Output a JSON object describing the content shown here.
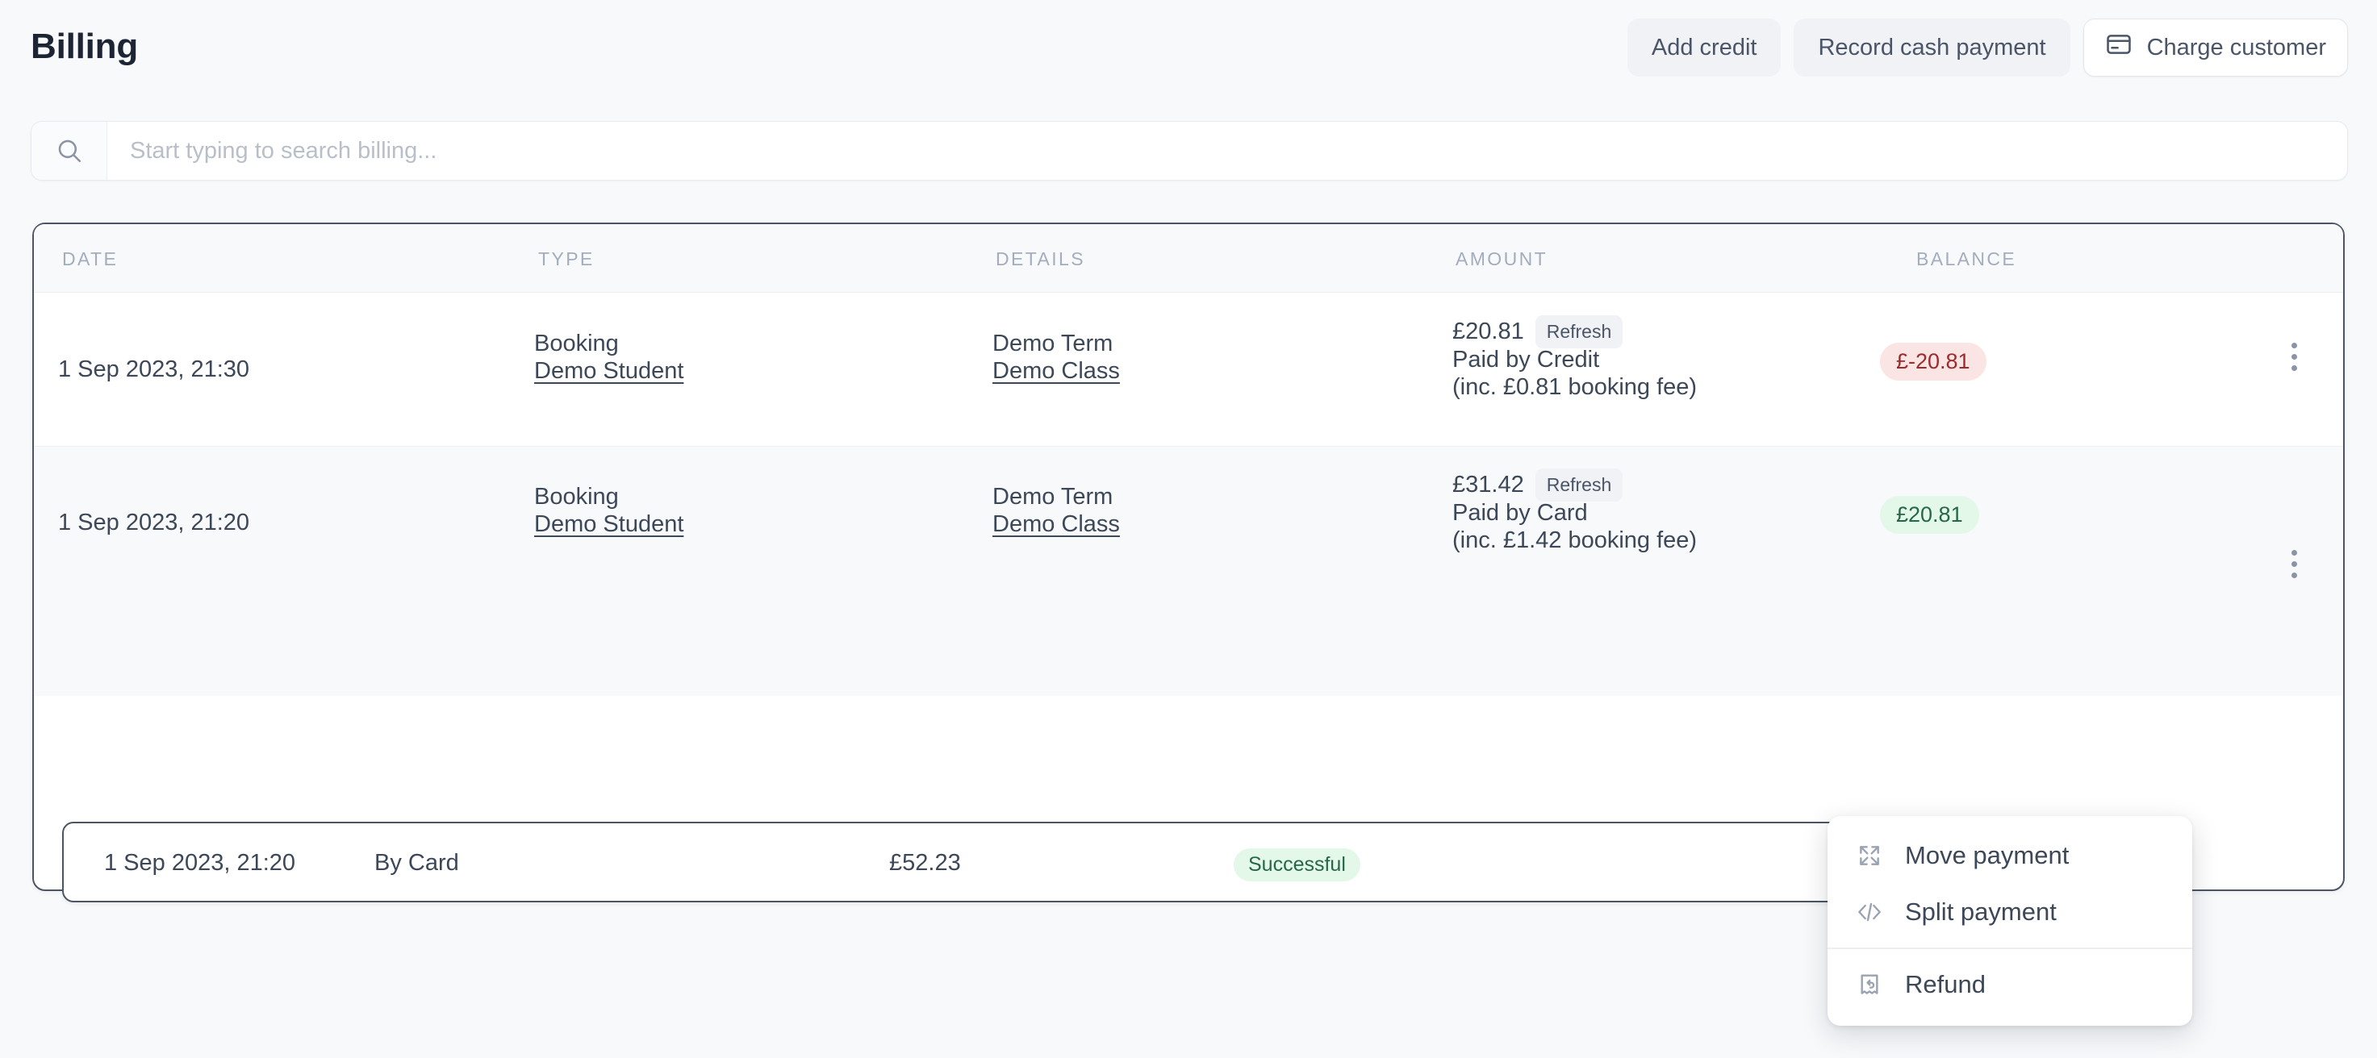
{
  "header": {
    "title": "Billing",
    "actions": [
      {
        "label": "Add credit",
        "name": "add-credit-button",
        "style": "ghost"
      },
      {
        "label": "Record cash payment",
        "name": "record-cash-payment-button",
        "style": "ghost"
      },
      {
        "label": "Charge customer",
        "name": "charge-customer-button",
        "style": "outline",
        "icon": "credit-card-icon"
      }
    ]
  },
  "search": {
    "placeholder": "Start typing to search billing...",
    "value": "",
    "icon": "search-icon"
  },
  "table": {
    "columns": [
      "DATE",
      "TYPE",
      "DETAILS",
      "AMOUNT",
      "BALANCE"
    ],
    "rows": [
      {
        "date": "1 Sep 2023, 21:30",
        "type": "Booking",
        "type_link": "Demo Student",
        "details": "Demo Term",
        "details_link": "Demo Class",
        "amount": "£20.81",
        "amount_badge": "Refresh",
        "paid_by": "Paid by Credit",
        "fee_note": "(inc. £0.81 booking fee)",
        "balance": "£-20.81",
        "balance_tone": "negative",
        "menu_icon": "kebab-menu-icon"
      },
      {
        "date": "1 Sep 2023, 21:20",
        "type": "Booking",
        "type_link": "Demo Student",
        "details": "Demo Term",
        "details_link": "Demo Class",
        "amount": "£31.42",
        "amount_badge": "Refresh",
        "paid_by": "Paid by Card",
        "fee_note": "(inc. £1.42 booking fee)",
        "balance": "£20.81",
        "balance_tone": "positive",
        "menu_icon": "kebab-menu-icon"
      }
    ],
    "payment": {
      "date": "1 Sep 2023, 21:20",
      "method": "By Card",
      "amount": "£52.23",
      "status": "Successful",
      "menu_icon": "kebab-menu-icon"
    }
  },
  "context_menu": {
    "items": [
      {
        "label": "Move payment",
        "icon": "expand-arrows-icon"
      },
      {
        "label": "Split payment",
        "icon": "code-brackets-icon"
      },
      {
        "label": "Refund",
        "icon": "receipt-refund-icon",
        "separator_before": true
      }
    ]
  },
  "colors": {
    "page_bg": "#f8f9fb",
    "border_strong": "#4b5563",
    "text": "#3c4758",
    "muted": "#a3adbd",
    "negative_bg": "#fbe4e4",
    "negative_fg": "#9b2c2c",
    "positive_bg": "#e3f8e8",
    "positive_fg": "#276749"
  }
}
